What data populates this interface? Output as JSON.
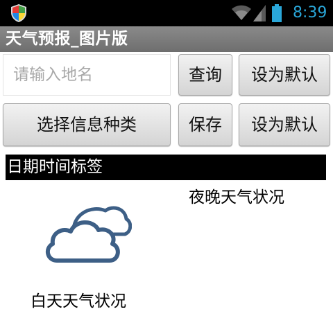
{
  "status_bar": {
    "time": "8:39",
    "icons": [
      "shield-icon",
      "wifi-icon",
      "signal-icon",
      "battery-icon"
    ],
    "time_color": "#2aa7d9"
  },
  "app": {
    "title": "天气预报_图片版"
  },
  "row1": {
    "city_input_placeholder": "请输入地名",
    "city_input_value": "",
    "query_button": "查询",
    "default_button": "设为默认"
  },
  "row2": {
    "select_info_button": "选择信息种类",
    "save_button": "保存",
    "default_button": "设为默认"
  },
  "content": {
    "date_time_label": "日期时间标签",
    "night_weather": "夜晚天气状况",
    "day_weather": "白天天气状况",
    "weather_icon": "cloudy-icon"
  },
  "colors": {
    "title_bar": "#777777",
    "date_bar": "#000000",
    "cloud_stroke": "#3d5f86"
  }
}
